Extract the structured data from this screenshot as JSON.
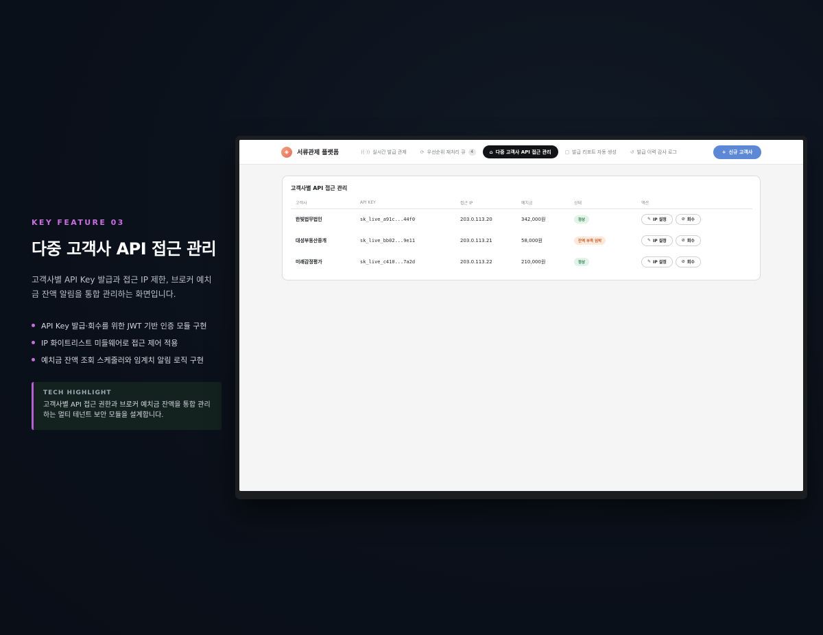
{
  "feature": {
    "eyebrow": "KEY FEATURE 03",
    "title": "다중 고객사 API 접근 관리",
    "description": "고객사별 API Key 발급과 접근 IP 제한, 브로커 예치금 잔액 알림을 통합 관리하는 화면입니다.",
    "bullets": [
      "API Key 발급·회수를 위한 JWT 기반 인증 모듈 구현",
      "IP 화이트리스트 미들웨어로 접근 제어 적용",
      "예치금 잔액 조회 스케줄러와 임계치 알림 로직 구현"
    ],
    "highlight": {
      "title": "TECH HIGHLIGHT",
      "text": "고객사별 API 접근 권한과 브로커 예치금 잔액을 통합 관리하는 멀티 테넌트 보안 모듈을 설계합니다."
    }
  },
  "app": {
    "brand": "서류관제 플랫폼",
    "nav": [
      {
        "label": "실시간 발급 관제",
        "icon": "signal-icon",
        "glyph": "((·))"
      },
      {
        "label": "우선순위 재처리 큐",
        "icon": "refresh-icon",
        "glyph": "⟳",
        "badge": "4"
      },
      {
        "label": "다중 고객사 API 접근 관리",
        "icon": "building-icon",
        "glyph": "⌂",
        "active": true
      },
      {
        "label": "발급 리포트 자동 생성",
        "icon": "document-icon",
        "glyph": "▢"
      },
      {
        "label": "발급 이력 감사 로그",
        "icon": "history-icon",
        "glyph": "↺"
      }
    ],
    "new_button": {
      "glyph": "+",
      "label": "신규 고객사"
    },
    "card_title": "고객사별 API 접근 관리",
    "columns": [
      "고객사",
      "API KEY",
      "접근 IP",
      "예치금",
      "상태",
      "액션"
    ],
    "rows": [
      {
        "client": "한빛법무법인",
        "key": "sk_live_a91c...44f0",
        "ip": "203.0.113.20",
        "deposit": "342,000원",
        "status": "정상",
        "status_type": "ok"
      },
      {
        "client": "대성부동산중개",
        "key": "sk_live_bb02...9e11",
        "ip": "203.0.113.21",
        "deposit": "58,000원",
        "status": "잔액 부족 임박",
        "status_type": "warn"
      },
      {
        "client": "미래감정평가",
        "key": "sk_live_c410...7a2d",
        "ip": "203.0.113.22",
        "deposit": "210,000원",
        "status": "정상",
        "status_type": "ok"
      }
    ],
    "actions": {
      "ip_label": "IP 설정",
      "revoke_label": "회수"
    }
  },
  "colors": {
    "accent": "#c96fe0",
    "primary_button": "#5c88d6",
    "status_ok": "#2f7f4d",
    "status_warn": "#c2602a"
  }
}
